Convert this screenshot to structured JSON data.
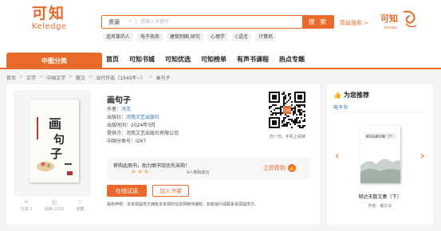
{
  "header": {
    "logo_cn": "可知",
    "logo_en": "Keledge",
    "search": {
      "type_label": "资源",
      "placeholder": "请输入关键字",
      "button_label": "搜 索"
    },
    "advanced_search": "高级搜索 >",
    "right_logo_text": "可知",
    "right_logo_sub": "Keledge",
    "hot_tags": [
      "追风筝的人",
      "电子商务",
      "建筑制图,研究",
      "心理学",
      "C语言",
      "计算机"
    ]
  },
  "nav": {
    "category_label": "中图分类",
    "items": [
      "首页",
      "可知书城",
      "可知优选",
      "可知榜单",
      "有声书课程",
      "热点专题"
    ]
  },
  "breadcrumb": [
    "首页",
    "文学",
    "中国文学",
    "散文",
    "当代作品（1949年~）",
    "画句子"
  ],
  "book": {
    "title": "画句子",
    "author_label": "作者：",
    "author": "冯杰",
    "publisher_label": "出版社：",
    "publisher": "河南文艺出版社",
    "pub_date_label": "出版时间：",
    "pub_date": "2024年3月",
    "provider_label": "提供方：",
    "provider": "河南文艺出版社有限公司",
    "clc_label": "中国分类号：",
    "clc": "I267",
    "cover_title": "画句子",
    "cover_author": "冯杰"
  },
  "actions": [
    {
      "icon": "share-icon",
      "label": "分享 2"
    },
    {
      "icon": "view-icon",
      "label": "阅读 1230"
    },
    {
      "icon": "bookmark-icon",
      "label": "收藏"
    }
  ],
  "qr": {
    "note": "扫一扫，手机上阅读",
    "badge": "可知"
  },
  "recommend": {
    "text": "荐购此图书，助力图书馆优先采购！",
    "count": "4人荐购成功",
    "button": "立即荐购"
  },
  "buttons": {
    "read_online": "在线试读",
    "add_shelf": "加入书架"
  },
  "copyright": "版权声明：本资源提供方拥有本资源的信息网络传播权，如有疑问请联系资源提供方。",
  "sidebar": {
    "heading": "为您推荐",
    "tab": "电子书",
    "book_title": "郁达夫散文集（下）",
    "book_author": "作者：郁达夫",
    "cover_title": "郁达夫散文集（下）"
  },
  "colors": {
    "accent": "#e96a2b",
    "link": "#2a6db5"
  }
}
